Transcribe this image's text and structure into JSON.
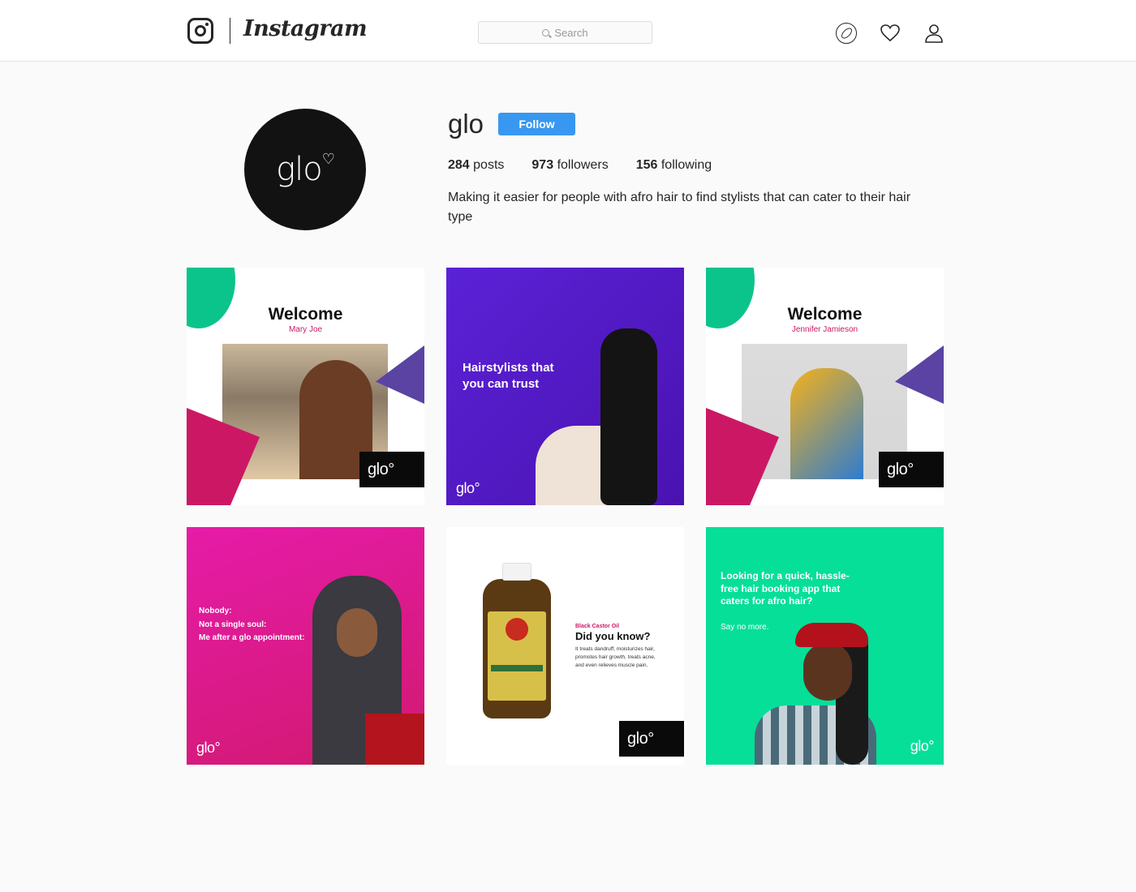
{
  "header": {
    "wordmark": "Instagram",
    "search_placeholder": "Search",
    "icons": [
      "instagram-logo-icon",
      "compass-icon",
      "heart-icon",
      "user-icon"
    ]
  },
  "profile": {
    "avatar_text": "glo",
    "username": "glo",
    "follow_label": "Follow",
    "stats": [
      {
        "value": "284",
        "label": "posts"
      },
      {
        "value": "973",
        "label": "followers"
      },
      {
        "value": "156",
        "label": "following"
      }
    ],
    "bio": "Making it easier for people with afro hair to find stylists that can cater to their hair type"
  },
  "posts": [
    {
      "title": "Welcome",
      "name": "Mary Joe",
      "badge": "glo"
    },
    {
      "text": "Hairstylists that you can trust",
      "badge": "glo"
    },
    {
      "title": "Welcome",
      "name": "Jennifer Jamieson",
      "badge": "glo"
    },
    {
      "lines": [
        "Nobody:",
        "Not a single soul:",
        "Me after a glo appointment:"
      ],
      "badge": "glo"
    },
    {
      "kicker": "Black Castor Oil",
      "headline": "Did you know?",
      "body": "It treats dandruff, moisturizes hair, promotes hair growth, treats acne, and even relieves muscle pain.",
      "badge": "glo"
    },
    {
      "text": "Looking for a quick, hassle-free hair booking app that caters for afro hair?",
      "sub": "Say no more.",
      "badge": "glo"
    }
  ],
  "colors": {
    "follow": "#3897f0",
    "pink": "#cc1864",
    "green": "#06df98",
    "purple": "#5a22d6"
  }
}
